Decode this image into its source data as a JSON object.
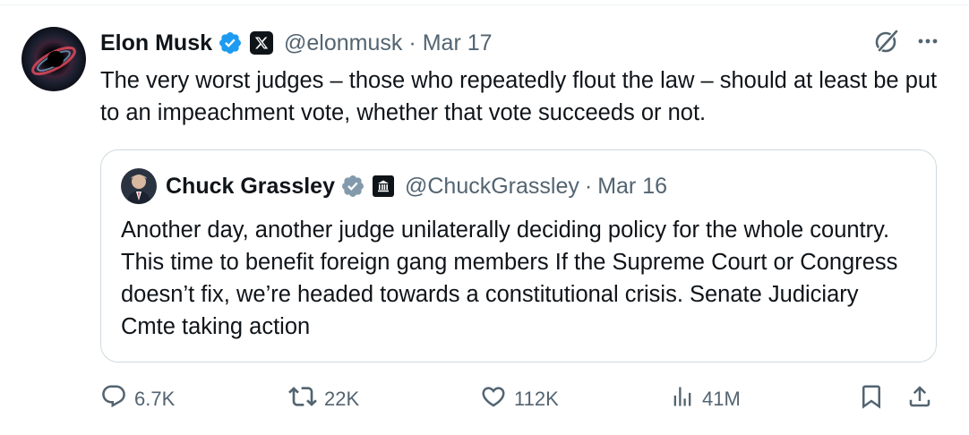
{
  "author": {
    "name": "Elon Musk",
    "handle": "@elonmusk",
    "separator": "·",
    "date": "Mar 17",
    "verified_color": "#1d9bf0"
  },
  "tweet": {
    "text": "The very worst judges – those who repeatedly flout the law – should at least be put to an impeachment vote, whether that vote succeeds or not."
  },
  "quoted": {
    "name": "Chuck Grassley",
    "handle": "@ChuckGrassley",
    "separator": "·",
    "date": "Mar 16",
    "verified_color": "#829aab",
    "text": "Another day, another judge unilaterally deciding policy for the whole country. This time to benefit foreign gang members If the Supreme Court or Congress doesn’t fix, we’re headed towards a constitutional crisis. Senate Judiciary Cmte taking action"
  },
  "metrics": {
    "replies": "6.7K",
    "reposts": "22K",
    "likes": "112K",
    "views": "41M"
  },
  "icons": {
    "top": [
      "grok-icon",
      "more-icon"
    ],
    "actions": [
      "reply-icon",
      "repost-icon",
      "like-icon",
      "views-icon",
      "bookmark-icon",
      "share-icon"
    ]
  }
}
